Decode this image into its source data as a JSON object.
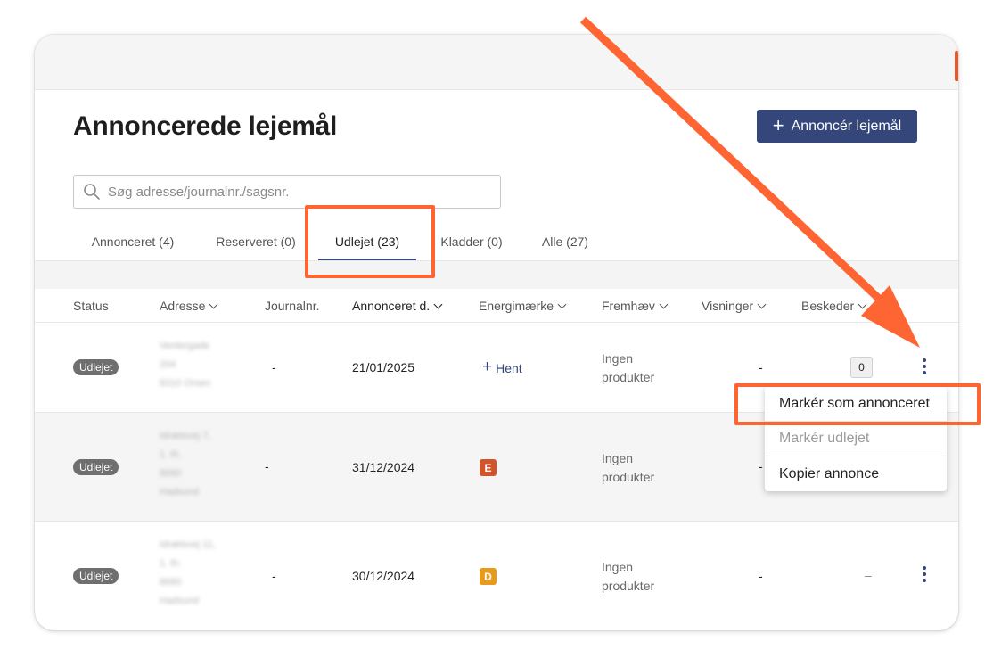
{
  "page": {
    "title": "Annoncerede lejemål",
    "create_button_label": "Annoncér lejemål",
    "search_placeholder": "Søg adresse/journalnr./sagsnr."
  },
  "tabs": [
    {
      "label": "Annonceret (4)",
      "active": false
    },
    {
      "label": "Reserveret (0)",
      "active": false
    },
    {
      "label": "Udlejet (23)",
      "active": true
    },
    {
      "label": "Kladder (0)",
      "active": false
    },
    {
      "label": "Alle (27)",
      "active": false
    }
  ],
  "columns": [
    {
      "label": "Status",
      "sortable": false
    },
    {
      "label": "Adresse",
      "sortable": true
    },
    {
      "label": "Journalnr.",
      "sortable": false
    },
    {
      "label": "Annonceret d.",
      "sortable": true
    },
    {
      "label": "Energimærke",
      "sortable": true
    },
    {
      "label": "Fremhæv",
      "sortable": true
    },
    {
      "label": "Visninger",
      "sortable": true
    },
    {
      "label": "Beskeder",
      "sortable": true
    }
  ],
  "rows": [
    {
      "status": "Udlejet",
      "address_lines": [
        "Ventergade",
        "204",
        "8310 Orsen"
      ],
      "journal": "-",
      "announced": "21/01/2025",
      "energy_action": "Hent",
      "energy_label": "",
      "energy_color": "",
      "featured_lines": [
        "Ingen",
        "produkter"
      ],
      "views": "-",
      "messages": "0"
    },
    {
      "status": "Udlejet",
      "address_lines": [
        "Idrætsvej 7,",
        "1. th.",
        "8680",
        "Hadsund"
      ],
      "journal": "-",
      "announced": "31/12/2024",
      "energy_action": "",
      "energy_label": "E",
      "energy_color": "#d2542a",
      "featured_lines": [
        "Ingen",
        "produkter"
      ],
      "views": "-",
      "messages": ""
    },
    {
      "status": "Udlejet",
      "address_lines": [
        "Idrætsvej 11,",
        "1. th.",
        "8680",
        "Hadsund"
      ],
      "journal": "-",
      "announced": "30/12/2024",
      "energy_action": "",
      "energy_label": "D",
      "energy_color": "#e89a1a",
      "featured_lines": [
        "Ingen",
        "produkter"
      ],
      "views": "-",
      "messages": "–"
    }
  ],
  "context_menu": {
    "items": [
      {
        "label": "Markér som annonceret",
        "enabled": true
      },
      {
        "label": "Markér udlejet",
        "enabled": false
      },
      {
        "label": "Kopier annonce",
        "enabled": true
      }
    ]
  },
  "annotation_color": "#ff6433",
  "accent_color": "#34467a"
}
